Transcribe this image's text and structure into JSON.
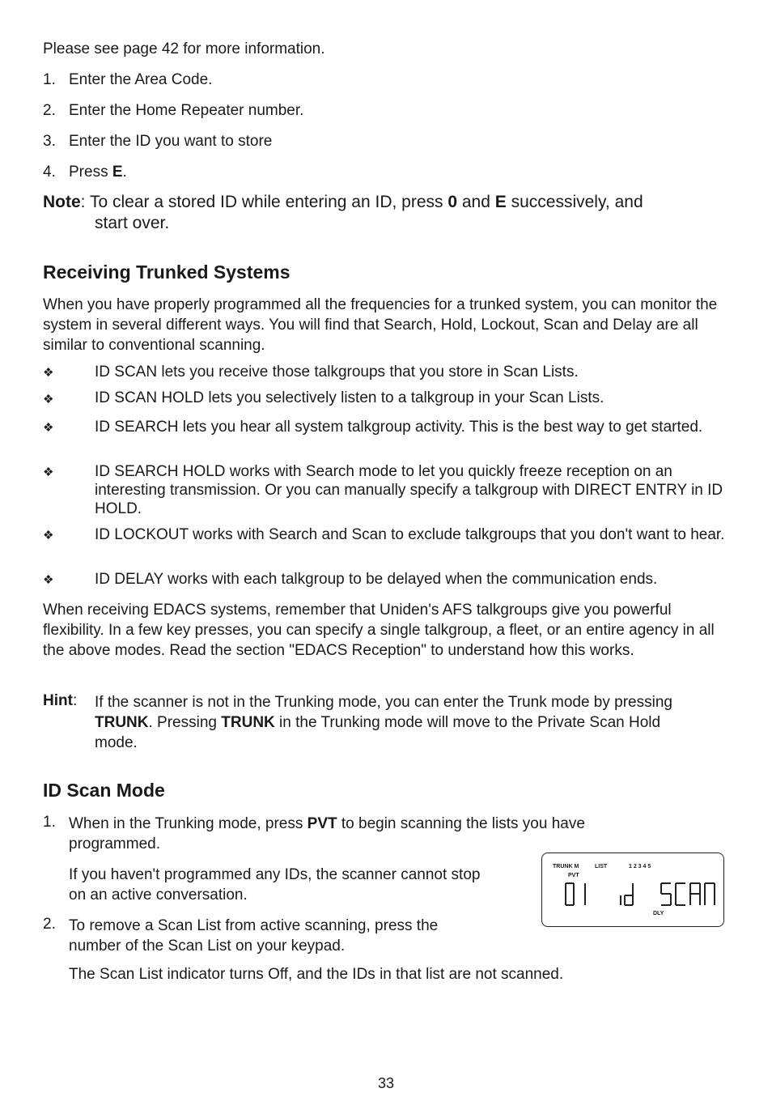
{
  "intro_line": "Please see page 42 for more information.",
  "steps_top": [
    {
      "num": "1.",
      "text": "Enter the Area Code."
    },
    {
      "num": "2.",
      "text": "Enter the Home Repeater number."
    },
    {
      "num": "3.",
      "text": "Enter the ID you want to store"
    },
    {
      "num": "4.",
      "text_before": "Press ",
      "bold": "E",
      "text_after": "."
    }
  ],
  "note": {
    "label": "Note",
    "line1_a": ": To clear a stored ID while entering an ID, press ",
    "b1": "0",
    "line1_b": " and ",
    "b2": "E",
    "line1_c": " successively, and",
    "line2": "start over."
  },
  "section1": {
    "heading": "Receiving Trunked Systems",
    "intro": "When you have properly programmed all the frequencies for a trunked system, you can monitor the system in several different ways. You will find that Search, Hold, Lockout, Scan and Delay are all similar to conventional scanning.",
    "bullets": [
      "ID SCAN lets you receive those talkgroups that you store in Scan Lists.",
      "ID SCAN HOLD lets you selectively listen to a talkgroup in your Scan Lists.",
      "ID SEARCH lets you hear all system talkgroup activity. This is the best way to get started.",
      "ID SEARCH HOLD works with Search mode to let you quickly freeze reception on an interesting transmission. Or you can manually specify a talkgroup with DIRECT ENTRY in ID HOLD.",
      "ID LOCKOUT works with Search and Scan to exclude talkgroups that you don't want to hear.",
      "ID DELAY works with each talkgroup to be delayed when the communication ends."
    ],
    "bullet_glyph": "❖",
    "edacs": "When receiving EDACS systems, remember that Uniden's AFS talkgroups give you powerful flexibility. In a few key presses, you can specify a single talkgroup, a fleet, or an entire agency in all the above modes. Read the section \"EDACS Reception\" to understand how this works.",
    "hint": {
      "label": "Hint",
      "a": "If the scanner is not in the Trunking mode, you can enter the Trunk mode by pressing",
      "b1": "TRUNK",
      "b": ". Pressing ",
      "b2": "TRUNK",
      "c": " in the Trunking mode will move to the Private Scan Hold",
      "d": "mode."
    }
  },
  "section2": {
    "heading": "ID Scan Mode",
    "step1": {
      "num": "1.",
      "a": "When in the Trunking mode, press ",
      "bold": "PVT",
      "b": " to begin scanning the lists you have",
      "c": "programmed."
    },
    "step1_note_l1": "If you haven't programmed any IDs, the scanner cannot stop",
    "step1_note_l2": "on an active conversation.",
    "step2": {
      "num": "2.",
      "l1": "To remove a Scan List from active scanning, press the",
      "l2": "number of the Scan List on your keypad."
    },
    "step2_note": "The Scan List indicator turns Off, and the IDs in that list are not scanned."
  },
  "lcd": {
    "trunk": "TRUNK M",
    "list": "LIST",
    "list_nums": "1 2 3 4 5",
    "pvt": "PVT",
    "channel": "01",
    "text": "id SCAn",
    "dly": "DLY"
  },
  "page_number": "33"
}
